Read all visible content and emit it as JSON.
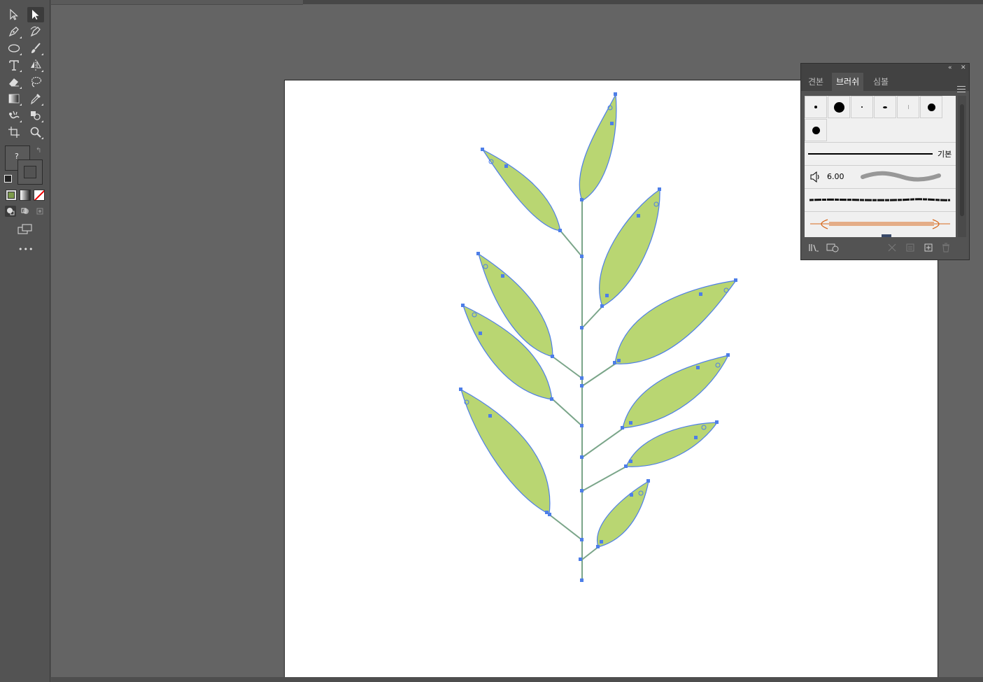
{
  "toolbar": {
    "tools": [
      {
        "name": "selection-tool-icon"
      },
      {
        "name": "direct-selection-tool-icon"
      },
      {
        "name": "pen-tool-icon"
      },
      {
        "name": "curvature-tool-icon"
      },
      {
        "name": "ellipse-tool-icon"
      },
      {
        "name": "paintbrush-tool-icon"
      },
      {
        "name": "type-tool-icon"
      },
      {
        "name": "reflect-tool-icon"
      },
      {
        "name": "eraser-tool-icon"
      },
      {
        "name": "lasso-tool-icon"
      },
      {
        "name": "gradient-tool-icon"
      },
      {
        "name": "eyedropper-tool-icon"
      },
      {
        "name": "puppet-warp-tool-icon"
      },
      {
        "name": "shape-builder-tool-icon"
      },
      {
        "name": "artboard-tool-icon"
      },
      {
        "name": "zoom-tool-icon"
      }
    ],
    "fill_stroke_label": "?",
    "more_label": "•••"
  },
  "brush_panel": {
    "tabs": [
      {
        "label": "견본",
        "active": false
      },
      {
        "label": "브러쉬",
        "active": true
      },
      {
        "label": "심볼",
        "active": false
      }
    ],
    "basic_label": "기본",
    "calligraphic_size": "6.00",
    "collapse_icon": "«",
    "close_icon": "✕"
  },
  "colors": {
    "leaf_fill": "#b9d672",
    "path_stroke": "#4d7ee8",
    "stem": "#7aa589",
    "anchor": "#4d7ee8"
  }
}
